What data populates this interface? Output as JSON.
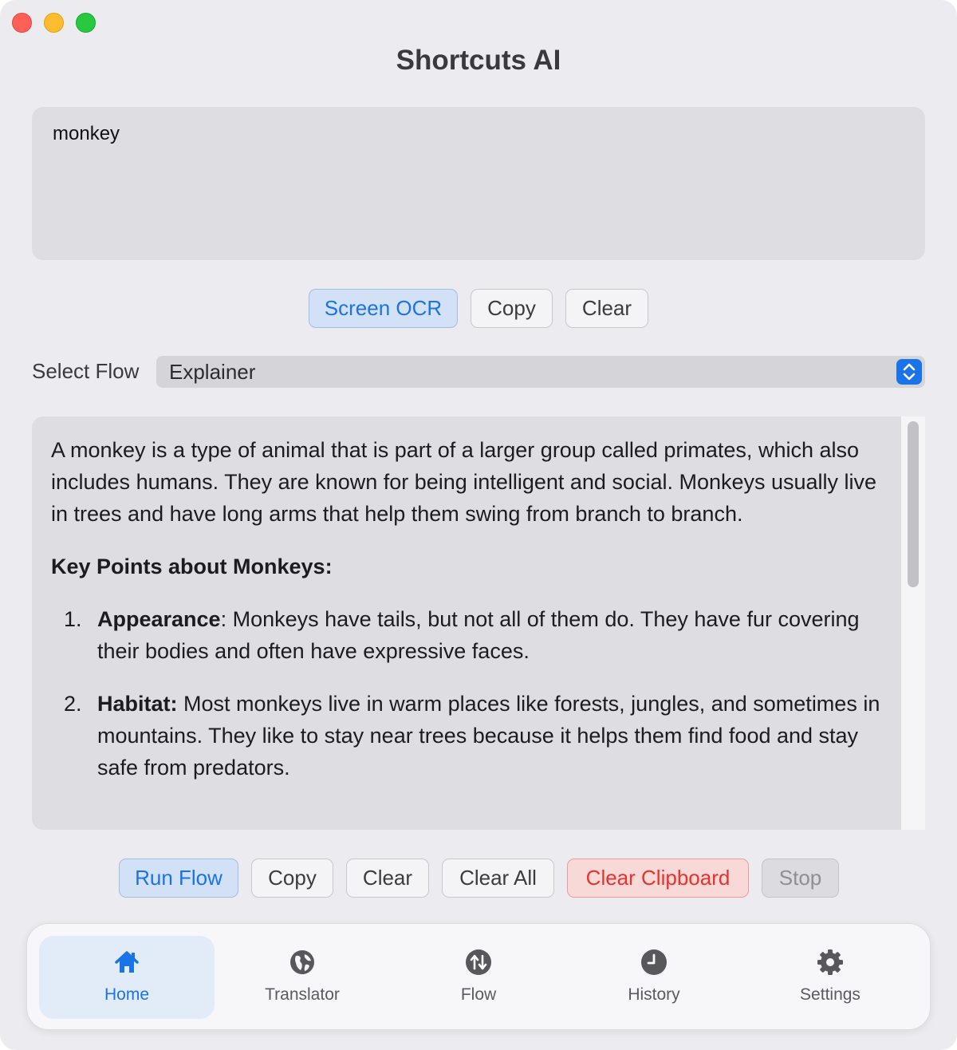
{
  "app": {
    "title": "Shortcuts AI"
  },
  "input": {
    "value": "monkey"
  },
  "top_buttons": {
    "screen_ocr": "Screen OCR",
    "copy": "Copy",
    "clear": "Clear"
  },
  "flow": {
    "label": "Select Flow",
    "selected": "Explainer"
  },
  "output": {
    "intro": "A monkey is a type of animal that is part of a larger group called primates, which also includes humans. They are known for being intelligent and social. Monkeys usually live in trees and have long arms that help them swing from branch to branch.",
    "heading": "Key Points about Monkeys:",
    "items": [
      {
        "num": "1.",
        "title": "Appearance",
        "text": ": Monkeys have tails, but not all of them do. They have fur covering their bodies and often have expressive faces."
      },
      {
        "num": "2.",
        "title": "Habitat:",
        "text": " Most monkeys live in warm places like forests, jungles, and sometimes in mountains. They like to stay near trees because it helps them find food and stay safe from predators."
      }
    ]
  },
  "bottom_buttons": {
    "run_flow": "Run Flow",
    "copy": "Copy",
    "clear": "Clear",
    "clear_all": "Clear All",
    "clear_clipboard": "Clear Clipboard",
    "stop": "Stop"
  },
  "tabs": [
    {
      "label": "Home",
      "icon": "house-icon",
      "active": true
    },
    {
      "label": "Translator",
      "icon": "globe-icon",
      "active": false
    },
    {
      "label": "Flow",
      "icon": "arrows-updown-icon",
      "active": false
    },
    {
      "label": "History",
      "icon": "clock-icon",
      "active": false
    },
    {
      "label": "Settings",
      "icon": "gear-icon",
      "active": false
    }
  ],
  "colors": {
    "accent": "#1a73e8",
    "danger": "#e8322b",
    "window_bg": "#ecebef"
  }
}
